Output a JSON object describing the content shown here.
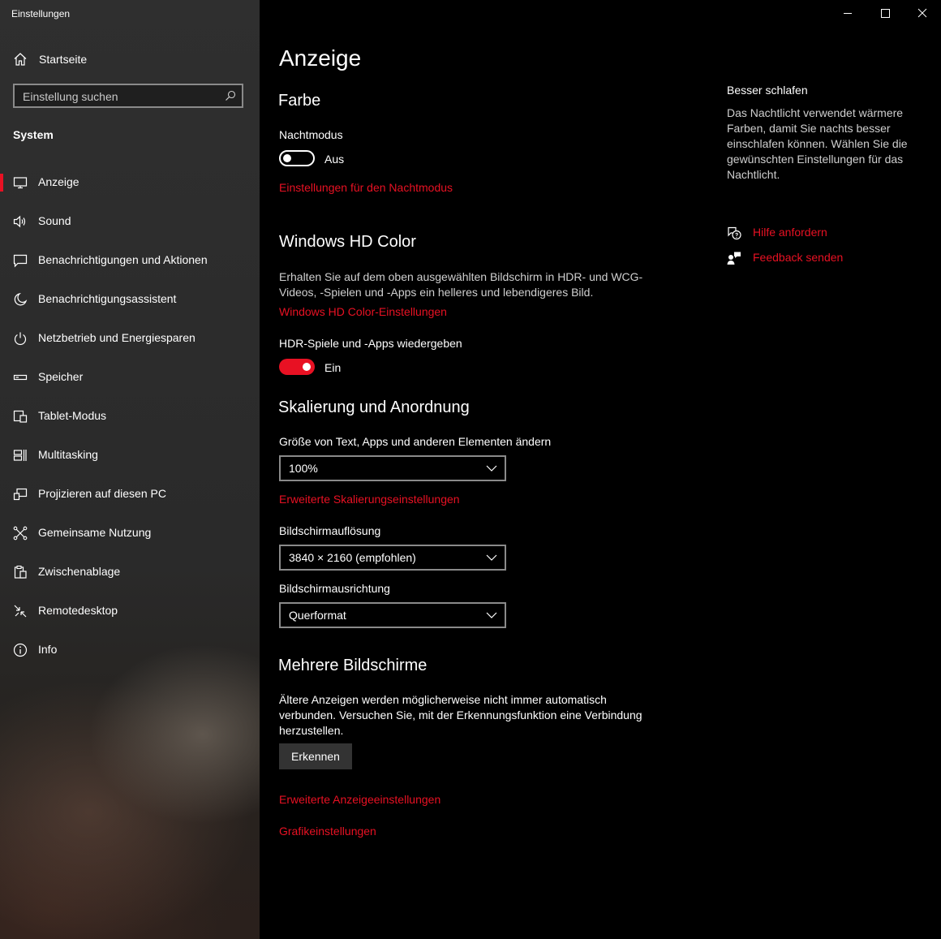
{
  "window": {
    "title": "Einstellungen"
  },
  "sidebar": {
    "home_label": "Startseite",
    "search_placeholder": "Einstellung suchen",
    "section_label": "System",
    "items": [
      {
        "label": "Anzeige",
        "icon": "monitor-icon",
        "active": true
      },
      {
        "label": "Sound",
        "icon": "speaker-icon"
      },
      {
        "label": "Benachrichtigungen und Aktionen",
        "icon": "message-icon"
      },
      {
        "label": "Benachrichtigungsassistent",
        "icon": "moon-icon"
      },
      {
        "label": "Netzbetrieb und Energiesparen",
        "icon": "power-icon"
      },
      {
        "label": "Speicher",
        "icon": "storage-icon"
      },
      {
        "label": "Tablet-Modus",
        "icon": "tablet-icon"
      },
      {
        "label": "Multitasking",
        "icon": "multitasking-icon"
      },
      {
        "label": "Projizieren auf diesen PC",
        "icon": "project-icon"
      },
      {
        "label": "Gemeinsame Nutzung",
        "icon": "share-icon"
      },
      {
        "label": "Zwischenablage",
        "icon": "clipboard-icon"
      },
      {
        "label": "Remotedesktop",
        "icon": "remote-icon"
      },
      {
        "label": "Info",
        "icon": "info-icon"
      }
    ]
  },
  "main": {
    "page_title": "Anzeige",
    "farbe": {
      "heading": "Farbe",
      "nachtmodus_label": "Nachtmodus",
      "nachtmodus_state": "Aus",
      "nachtmodus_on": false,
      "nachtmodus_link": "Einstellungen für den Nachtmodus"
    },
    "hdr": {
      "heading": "Windows HD Color",
      "description": "Erhalten Sie auf dem oben ausgewählten Bildschirm in HDR- und WCG-Videos, -Spielen und -Apps ein helleres und lebendigeres Bild.",
      "link": "Windows HD Color-Einstellungen",
      "toggle_label": "HDR-Spiele und -Apps wiedergeben",
      "toggle_state": "Ein",
      "toggle_on": true
    },
    "scaling": {
      "heading": "Skalierung und Anordnung",
      "size_label": "Größe von Text, Apps und anderen Elementen ändern",
      "size_value": "100%",
      "advanced_link": "Erweiterte Skalierungseinstellungen",
      "resolution_label": "Bildschirmauflösung",
      "resolution_value": "3840 × 2160 (empfohlen)",
      "orientation_label": "Bildschirmausrichtung",
      "orientation_value": "Querformat"
    },
    "multi": {
      "heading": "Mehrere Bildschirme",
      "description": "Ältere Anzeigen werden möglicherweise nicht immer automatisch verbunden. Versuchen Sie, mit der Erkennungsfunktion eine Verbindung herzustellen.",
      "detect_button": "Erkennen"
    },
    "links": {
      "advanced_display": "Erweiterte Anzeigeeinstellungen",
      "graphics": "Grafikeinstellungen"
    }
  },
  "aside": {
    "heading": "Besser schlafen",
    "text": "Das Nachtlicht verwendet wärmere Farben, damit Sie nachts besser einschlafen können. Wählen Sie die gewünschten Einstellungen für das Nachtlicht.",
    "help_link": "Hilfe anfordern",
    "feedback_link": "Feedback senden"
  },
  "colors": {
    "accent": "#e81123",
    "sidebar_bg": "#2b2b2b",
    "main_bg": "#000000"
  }
}
